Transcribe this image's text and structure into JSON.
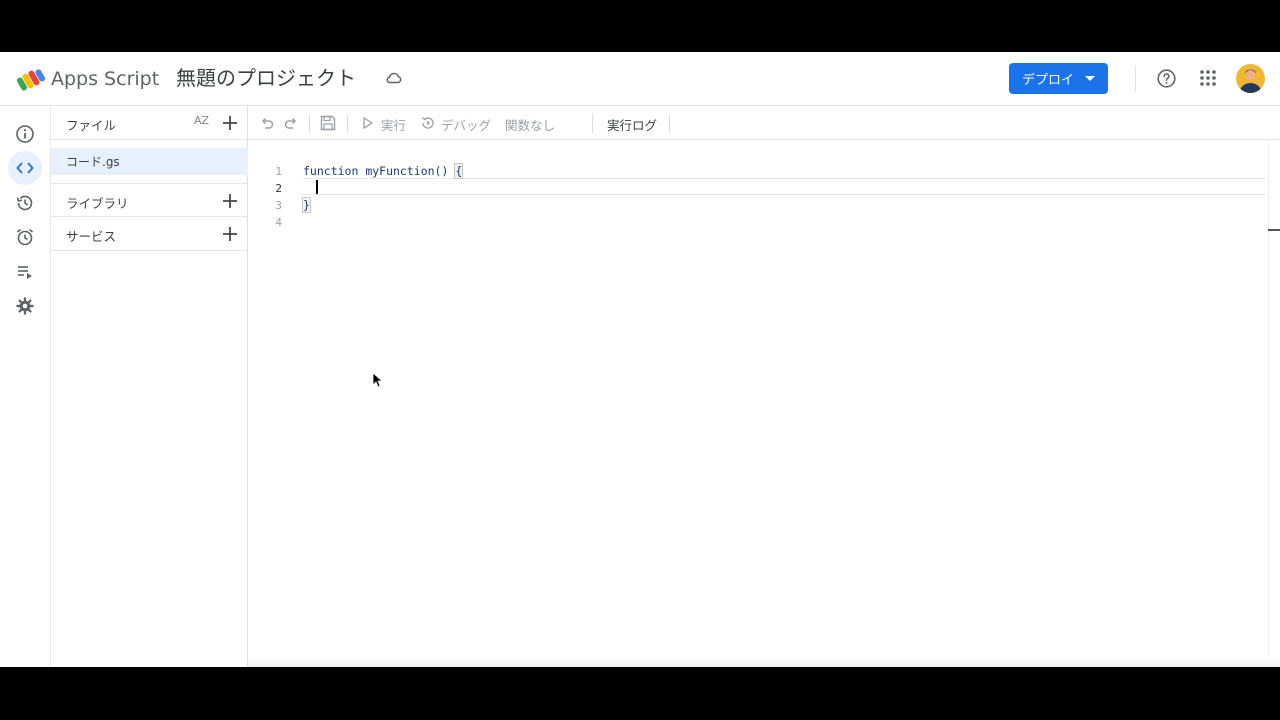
{
  "header": {
    "brand": "Apps Script",
    "project_title": "無題のプロジェクト",
    "deploy_label": "デプロイ"
  },
  "rail": {
    "items": [
      {
        "icon": "info-icon",
        "active": false
      },
      {
        "icon": "code-icon",
        "active": true
      },
      {
        "icon": "history-icon",
        "active": false
      },
      {
        "icon": "alarm-icon",
        "active": false
      },
      {
        "icon": "playlist-icon",
        "active": false
      },
      {
        "icon": "gear-icon",
        "active": false
      }
    ]
  },
  "files_panel": {
    "files_header": "ファイル",
    "sort_label": "AZ",
    "files": [
      "コード.gs"
    ],
    "libraries_label": "ライブラリ",
    "services_label": "サービス"
  },
  "toolbar": {
    "run_label": "実行",
    "debug_label": "デバッグ",
    "function_select": "関数なし",
    "log_label": "実行ログ"
  },
  "editor": {
    "line_numbers": [
      "1",
      "2",
      "3",
      "4"
    ],
    "current_line": 2,
    "code": {
      "line1_keyword": "function",
      "line1_name": " myFunction() ",
      "line1_brace": "{",
      "line3_brace": "}"
    }
  },
  "colors": {
    "accent": "#1a73e8",
    "active_bg": "#e8f0fe"
  }
}
